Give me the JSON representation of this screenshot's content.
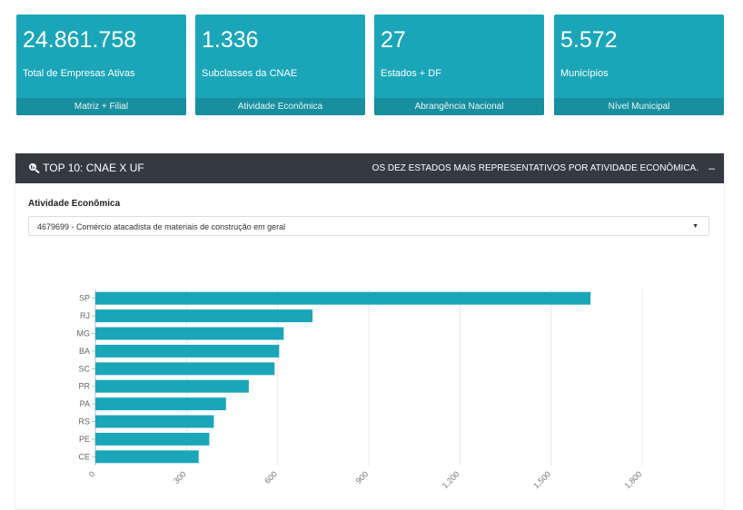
{
  "kpis": [
    {
      "value": "24.861.758",
      "label": "Total de Empresas Ativas",
      "footer": "Matriz + Filial"
    },
    {
      "value": "1.336",
      "label": "Subclasses da CNAE",
      "footer": "Atividade Econômica"
    },
    {
      "value": "27",
      "label": "Estados + DF",
      "footer": "Abrangência Nacional"
    },
    {
      "value": "5.572",
      "label": "Municípios",
      "footer": "Nível Municipal"
    }
  ],
  "panel": {
    "title": "TOP 10: CNAE X UF",
    "subtitle": "OS DEZ ESTADOS MAIS REPRESENTATIVOS POR ATIVIDADE ECONÔMICA.",
    "collapse": "–",
    "filter_label": "Atividade Econômica",
    "filter_value": "4679699 - Comércio atacadista de materiais de construção em geral"
  },
  "colors": {
    "accent": "#1aa6b8",
    "header": "#343a40"
  },
  "icons": {
    "title": "search-chart-icon",
    "select": "caret-down-icon"
  },
  "chart_data": {
    "type": "bar",
    "orientation": "horizontal",
    "categories": [
      "SP",
      "RJ",
      "MG",
      "BA",
      "SC",
      "PR",
      "PA",
      "RS",
      "PE",
      "CE"
    ],
    "values": [
      1630,
      715,
      620,
      605,
      590,
      505,
      430,
      390,
      375,
      340
    ],
    "xlim": [
      0,
      1800
    ],
    "xticks": [
      "0",
      "300",
      "600",
      "900",
      "1,200",
      "1,500",
      "1,800"
    ],
    "grid": true,
    "color": "#1aa6b8"
  }
}
